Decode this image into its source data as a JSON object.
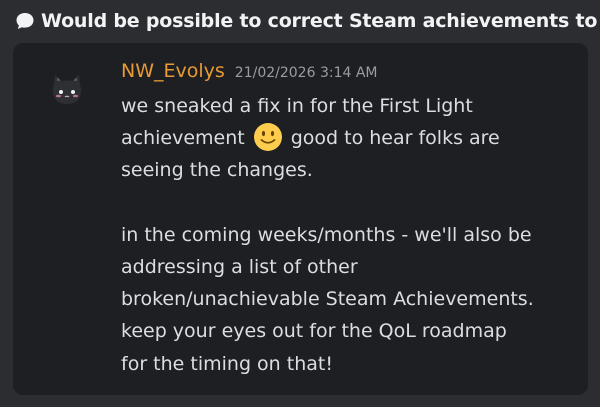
{
  "thread": {
    "icon": "chat-bubble-icon",
    "title": "Would be possible to correct Steam achievements to"
  },
  "message": {
    "avatar": "cat-avatar",
    "username": "NW_Evolys",
    "timestamp": "21/02/2026 3:14 AM",
    "username_color": "#e89b34",
    "lines": [
      "we sneaked a fix in for the First Light",
      "achievement",
      "good to hear folks are",
      "seeing the changes.",
      "in the coming weeks/months - we'll also be",
      "addressing a list of other",
      "broken/unachievable Steam Achievements.",
      "keep your eyes out for the QoL roadmap",
      "for the timing on that!"
    ],
    "emoji": "slightly-smiling-face-emoji"
  }
}
